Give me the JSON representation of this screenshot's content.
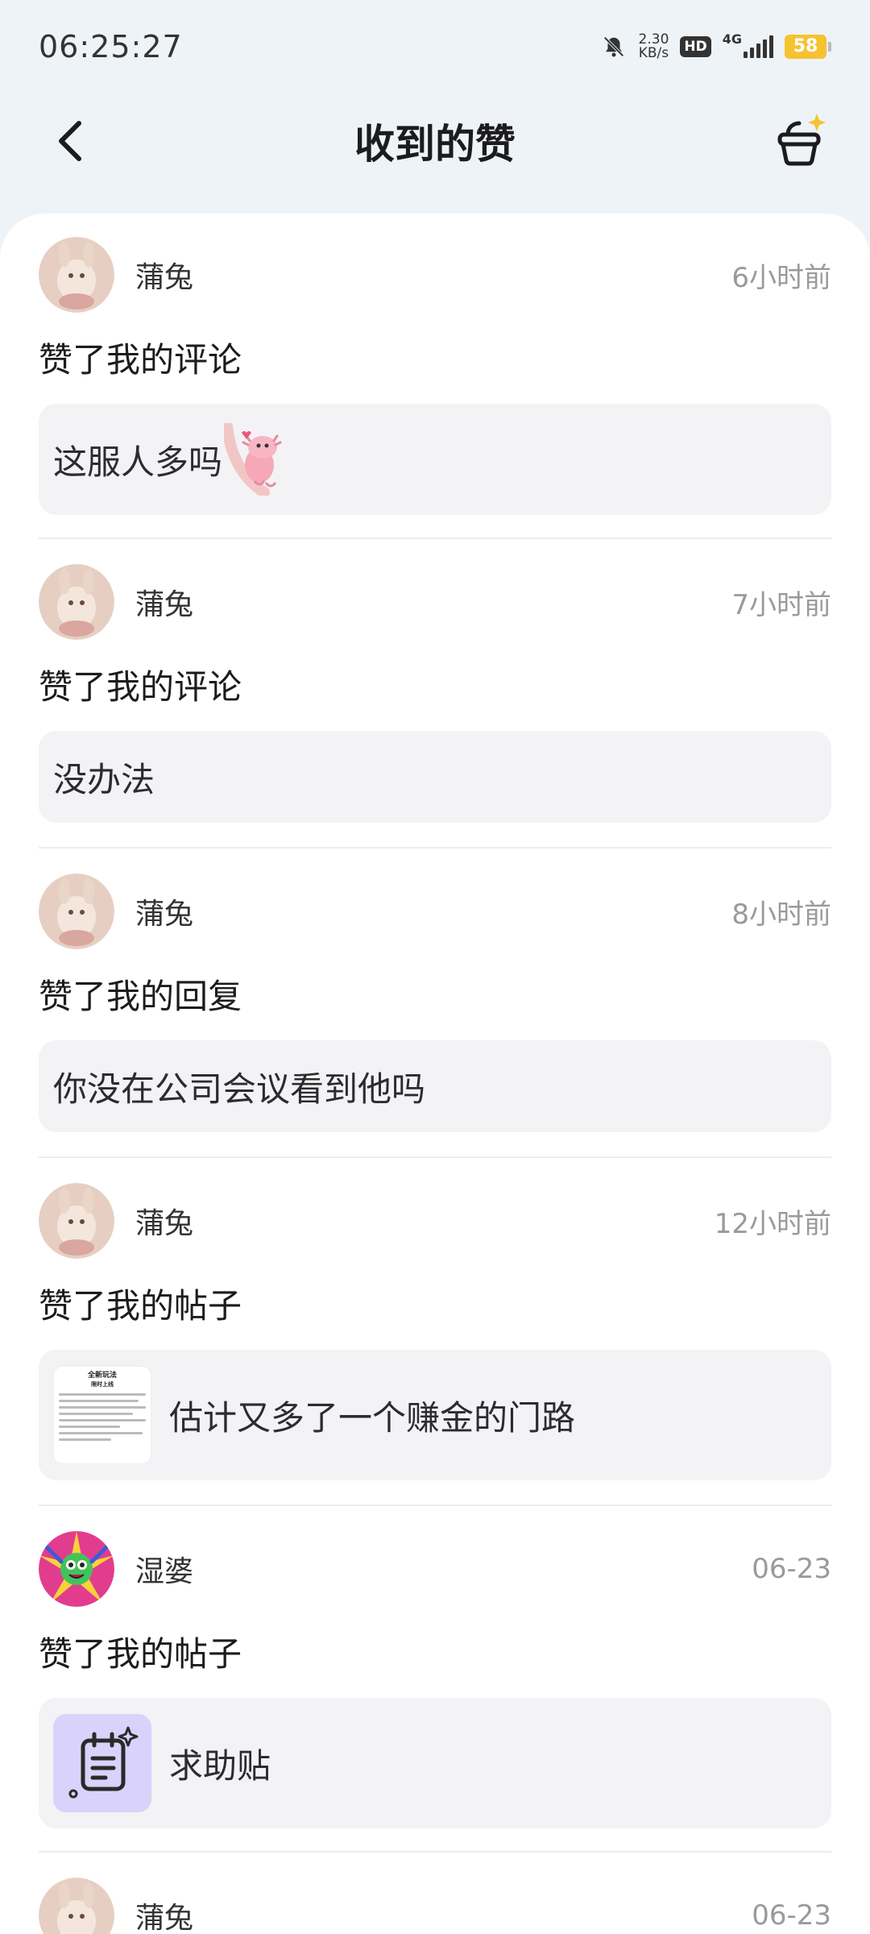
{
  "status_bar": {
    "time": "06:25:27",
    "net_speed_value": "2.30",
    "net_speed_unit": "KB/s",
    "hd_label": "HD",
    "network_type": "4G",
    "battery": "58",
    "colors": {
      "battery": "#f6c230"
    }
  },
  "header": {
    "title": "收到的赞",
    "icons": {
      "back": "back-arrow-icon",
      "basket": "basket-sparkle-icon"
    }
  },
  "likes": [
    {
      "user": "蒲兔",
      "time": "6小时前",
      "action": "赞了我的评论",
      "quote": "这服人多吗",
      "has_sticker": true
    },
    {
      "user": "蒲兔",
      "time": "7小时前",
      "action": "赞了我的评论",
      "quote": "没办法"
    },
    {
      "user": "蒲兔",
      "time": "8小时前",
      "action": "赞了我的回复",
      "quote": "你没在公司会议看到他吗"
    },
    {
      "user": "蒲兔",
      "time": "12小时前",
      "action": "赞了我的帖子",
      "quote": "估计又多了一个赚金的门路",
      "thumb_title": "全新玩法",
      "thumb_subtitle": "限时上线"
    },
    {
      "user": "湿婆",
      "time": "06-23",
      "action": "赞了我的帖子",
      "quote": "求助贴"
    },
    {
      "user": "蒲兔",
      "time": "06-23"
    }
  ]
}
